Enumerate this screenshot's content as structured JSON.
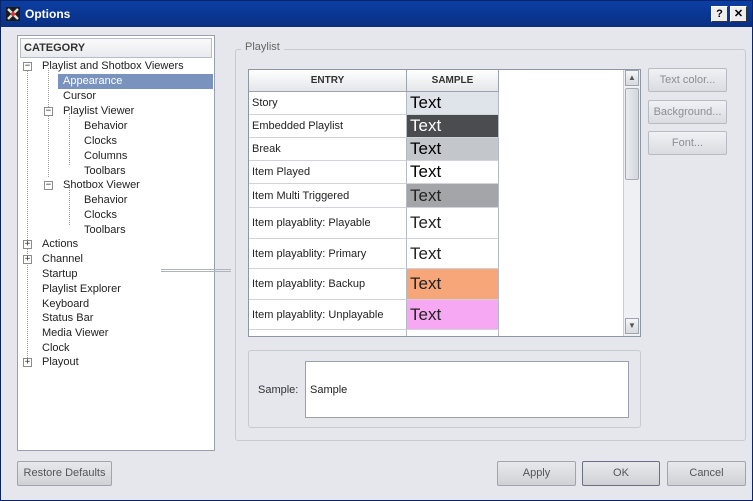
{
  "window": {
    "title": "Options",
    "help_label": "?",
    "close_label": "✕"
  },
  "category": {
    "header": "CATEGORY",
    "items": [
      {
        "label": "Playlist and Shotbox Viewers",
        "expander": "−"
      },
      {
        "label": "Appearance"
      },
      {
        "label": "Cursor"
      },
      {
        "label": "Playlist Viewer",
        "expander": "−"
      },
      {
        "label": "Behavior"
      },
      {
        "label": "Clocks"
      },
      {
        "label": "Columns"
      },
      {
        "label": "Toolbars"
      },
      {
        "label": "Shotbox Viewer",
        "expander": "−"
      },
      {
        "label": "Behavior"
      },
      {
        "label": "Clocks"
      },
      {
        "label": "Toolbars"
      },
      {
        "label": "Actions",
        "expander": "+"
      },
      {
        "label": "Channel",
        "expander": "+"
      },
      {
        "label": "Startup"
      },
      {
        "label": "Playlist Explorer"
      },
      {
        "label": "Keyboard"
      },
      {
        "label": "Status Bar"
      },
      {
        "label": "Media Viewer"
      },
      {
        "label": "Clock"
      },
      {
        "label": "Playout",
        "expander": "+"
      }
    ]
  },
  "playlist": {
    "group_label": "Playlist",
    "columns": {
      "entry": "ENTRY",
      "sample": "SAMPLE"
    },
    "rows": [
      {
        "entry": "Story",
        "sample": "Text",
        "bg": "#dfe3ea",
        "fg": "#000000"
      },
      {
        "entry": "Embedded Playlist",
        "sample": "Text",
        "bg": "#4b4c4f",
        "fg": "#ffffff"
      },
      {
        "entry": "Break",
        "sample": "Text",
        "bg": "#c3c6cb",
        "fg": "#000000"
      },
      {
        "entry": "Item Played",
        "sample": "Text",
        "bg": "#ffffff",
        "fg": "#000000"
      },
      {
        "entry": "Item Multi Triggered",
        "sample": "Text",
        "bg": "#a4a5a8",
        "fg": "#222222"
      },
      {
        "entry": "Item playablity: Playable",
        "sample": "Text",
        "bg": "#ffffff",
        "fg": "#222222"
      },
      {
        "entry": "Item playablity: Primary",
        "sample": "Text",
        "bg": "#ffffff",
        "fg": "#222222"
      },
      {
        "entry": "Item playablity: Backup",
        "sample": "Text",
        "bg": "#f6a678",
        "fg": "#222222"
      },
      {
        "entry": "Item playablity: Unplayable",
        "sample": "Text",
        "bg": "#f7a8f2",
        "fg": "#222222"
      }
    ],
    "buttons": {
      "text_color": "Text color...",
      "background": "Background...",
      "font": "Font..."
    }
  },
  "sample": {
    "label": "Sample:",
    "value": "Sample"
  },
  "footer": {
    "restore_defaults": "Restore Defaults",
    "apply": "Apply",
    "ok": "OK",
    "cancel": "Cancel"
  }
}
